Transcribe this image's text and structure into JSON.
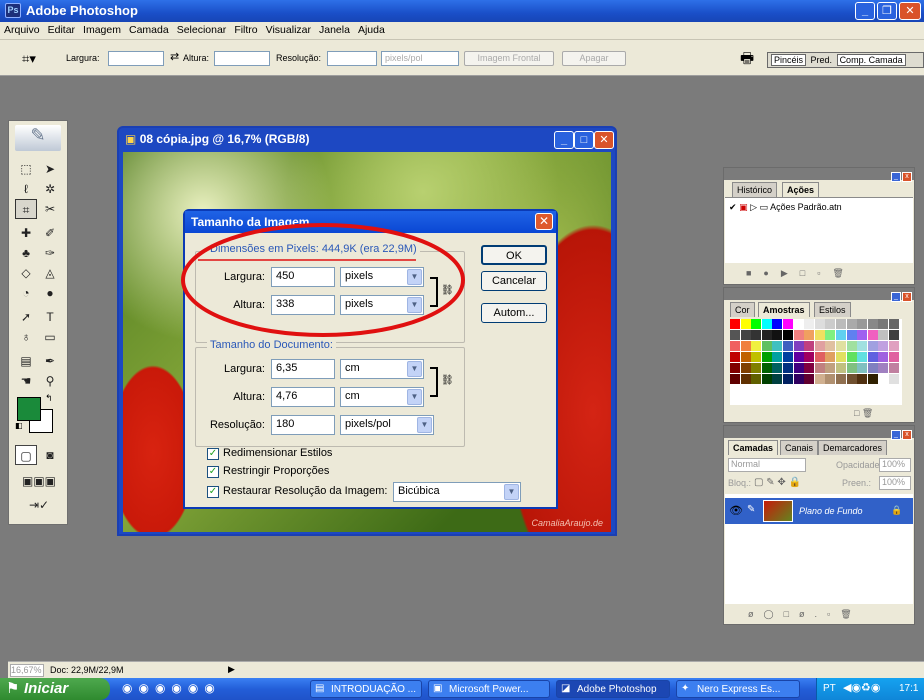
{
  "app": {
    "title": "Adobe Photoshop"
  },
  "menu": [
    "Arquivo",
    "Editar",
    "Imagem",
    "Camada",
    "Selecionar",
    "Filtro",
    "Visualizar",
    "Janela",
    "Ajuda"
  ],
  "options_bar": {
    "largura_label": "Largura:",
    "altura_label": "Altura:",
    "resolucao_label": "Resolução:",
    "unit": "pixels/pol",
    "front_image_btn": "Imagem Frontal",
    "clear_btn": "Apagar",
    "tabs": [
      "Pincéis",
      "Pred.",
      "Comp. Camada"
    ]
  },
  "document": {
    "title": "08 cópia.jpg @ 16,7% (RGB/8)",
    "watermark": "CamaliaAraujo.de"
  },
  "dialog": {
    "title": "Tamanho da Imagem",
    "pixel_dims_title": "Dimensões em Pixels: 444,9K (era 22,9M)",
    "px_width_label": "Largura:",
    "px_width_value": "450",
    "px_width_unit": "pixels",
    "px_height_label": "Altura:",
    "px_height_value": "338",
    "px_height_unit": "pixels",
    "doc_size_title": "Tamanho do Documento:",
    "doc_width_label": "Largura:",
    "doc_width_value": "6,35",
    "doc_width_unit": "cm",
    "doc_height_label": "Altura:",
    "doc_height_value": "4,76",
    "doc_height_unit": "cm",
    "res_label": "Resolução:",
    "res_value": "180",
    "res_unit": "pixels/pol",
    "ok": "OK",
    "cancel": "Cancelar",
    "auto": "Autom...",
    "chk1": "Redimensionar Estilos",
    "chk2": "Restringir Proporções",
    "chk3": "Restaurar Resolução da Imagem:",
    "resample": "Bicúbica"
  },
  "history_panel": {
    "tabs": [
      "Histórico",
      "Ações"
    ],
    "item": "Ações Padrão.atn"
  },
  "color_panel": {
    "tabs": [
      "Cor",
      "Amostras",
      "Estilos"
    ]
  },
  "layers_panel": {
    "tabs": [
      "Camadas",
      "Canais",
      "Demarcadores"
    ],
    "blend": "Normal",
    "opacity_label": "Opacidade:",
    "opacity": "100%",
    "lock_label": "Bloq.:",
    "fill_label": "Preen.:",
    "fill": "100%",
    "layer_name": "Plano de Fundo"
  },
  "status": {
    "zoom": "16,67%",
    "doc": "Doc: 22,9M/22,9M"
  },
  "taskbar": {
    "start": "Iniciar",
    "items": [
      "INTRODUAÇÃO ...",
      "Microsoft Power...",
      "Adobe Photoshop",
      "Nero Express Es..."
    ],
    "lang": "PT",
    "clock": "17:1"
  },
  "colors": {
    "foreground": "#1a8a3a",
    "background": "#ffffff",
    "annotation": "#e01010"
  }
}
